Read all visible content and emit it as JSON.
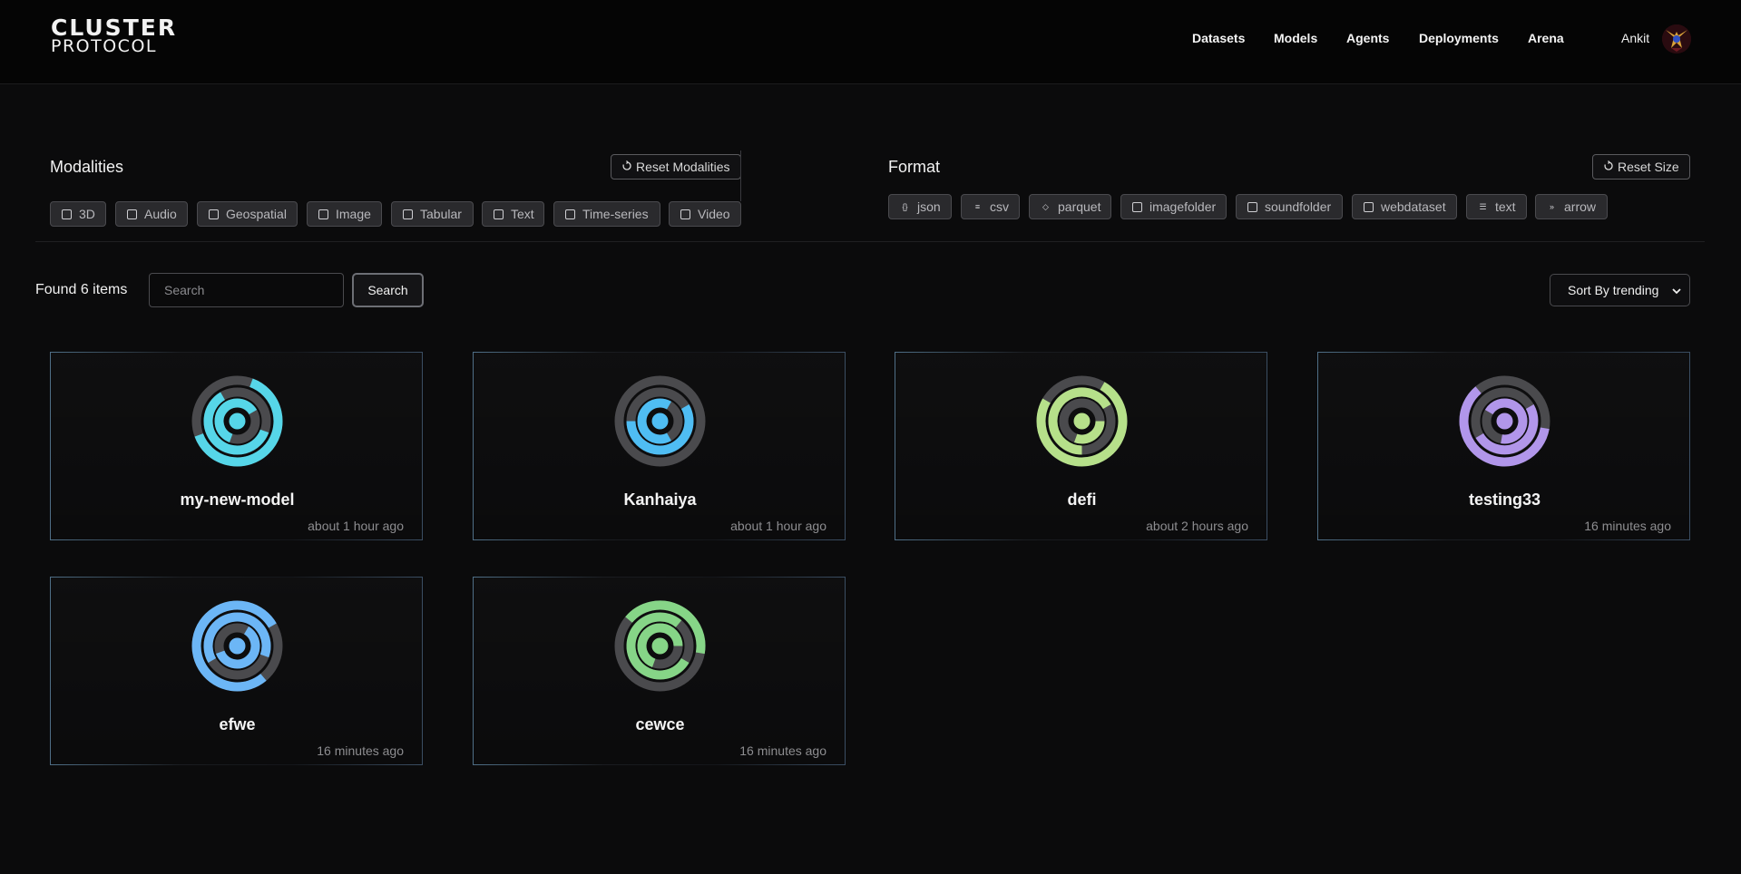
{
  "header": {
    "logo_line1": "CLUSTER",
    "logo_line2": "PROTOCOL",
    "nav": [
      "Datasets",
      "Models",
      "Agents",
      "Deployments",
      "Arena"
    ],
    "username": "Ankit"
  },
  "filters": {
    "modalities": {
      "title": "Modalities",
      "reset_label": "Reset Modalities",
      "chips": [
        {
          "label": "3D",
          "icon": "cube-icon"
        },
        {
          "label": "Audio",
          "icon": "audio-icon"
        },
        {
          "label": "Geospatial",
          "icon": "globe-icon"
        },
        {
          "label": "Image",
          "icon": "image-icon"
        },
        {
          "label": "Tabular",
          "icon": "table-icon"
        },
        {
          "label": "Text",
          "icon": "text-icon"
        },
        {
          "label": "Time-series",
          "icon": "timeseries-icon"
        },
        {
          "label": "Video",
          "icon": "video-icon"
        }
      ]
    },
    "format": {
      "title": "Format",
      "reset_label": "Reset Size",
      "chips": [
        {
          "label": "json",
          "icon": "braces-icon"
        },
        {
          "label": "csv",
          "icon": "csv-icon"
        },
        {
          "label": "parquet",
          "icon": "parquet-icon"
        },
        {
          "label": "imagefolder",
          "icon": "folder-image-icon"
        },
        {
          "label": "soundfolder",
          "icon": "folder-sound-icon"
        },
        {
          "label": "webdataset",
          "icon": "webdataset-icon"
        },
        {
          "label": "text",
          "icon": "lines-icon"
        },
        {
          "label": "arrow",
          "icon": "double-chevron-icon"
        }
      ]
    }
  },
  "results": {
    "found_label": "Found 6 items",
    "search_placeholder": "Search",
    "search_button": "Search",
    "sort_label": "Sort By trending"
  },
  "models": [
    {
      "name": "my-new-model",
      "time": "about 1 hour ago",
      "color": "#56d6e8"
    },
    {
      "name": "Kanhaiya",
      "time": "about 1 hour ago",
      "color": "#4fbdf3"
    },
    {
      "name": "defi",
      "time": "about 2 hours ago",
      "color": "#b6e08a"
    },
    {
      "name": "testing33",
      "time": "16 minutes ago",
      "color": "#b196ea"
    },
    {
      "name": "efwe",
      "time": "16 minutes ago",
      "color": "#6cb6f6"
    },
    {
      "name": "cewce",
      "time": "16 minutes ago",
      "color": "#86d587"
    }
  ],
  "colors": {
    "background": "#0b0b0c",
    "ring_gray": "#4a4a4d"
  }
}
